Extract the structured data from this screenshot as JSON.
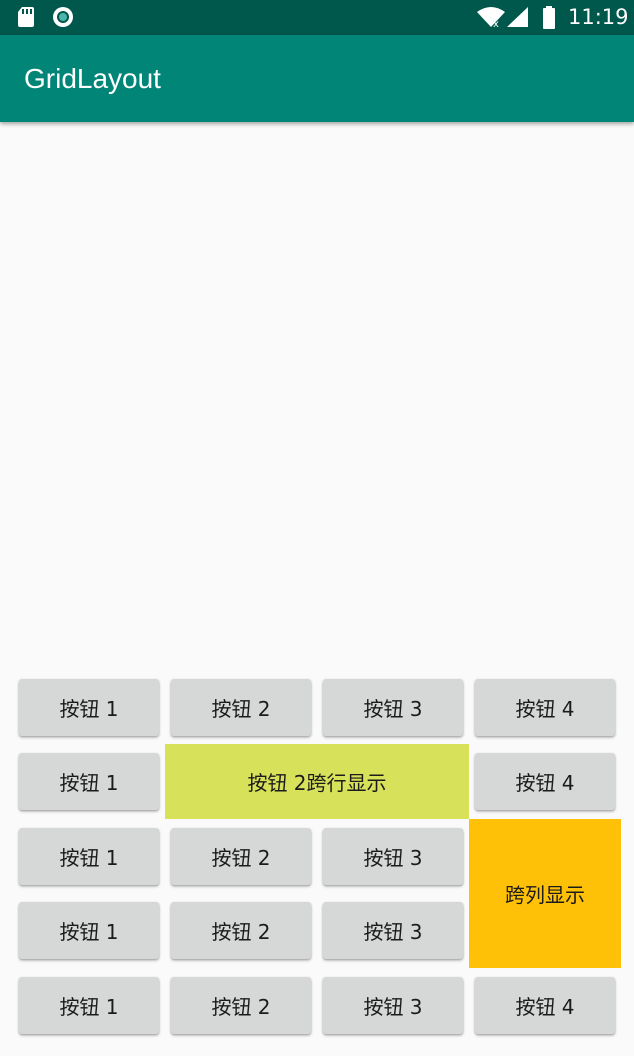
{
  "status_bar": {
    "time": "11:19",
    "icons": [
      "sd-card-icon",
      "sync-icon",
      "wifi-icon",
      "signal-icon",
      "battery-icon"
    ]
  },
  "app_bar": {
    "title": "GridLayout"
  },
  "grid": {
    "rows": [
      [
        "按钮 1",
        "按钮 2",
        "按钮 3",
        "按钮 4"
      ],
      [
        "按钮 1",
        "按钮 2跨行显示",
        "按钮 4"
      ],
      [
        "按钮 1",
        "按钮 2",
        "按钮 3",
        "跨列显示"
      ],
      [
        "按钮 1",
        "按钮 2",
        "按钮 3"
      ],
      [
        "按钮 1",
        "按钮 2",
        "按钮 3",
        "按钮 4"
      ]
    ]
  },
  "colors": {
    "status_bar": "#00574b",
    "app_bar": "#008577",
    "button": "#d6d7d7",
    "row_span_button": "#d7e15a",
    "col_span_button": "#ffc107"
  }
}
